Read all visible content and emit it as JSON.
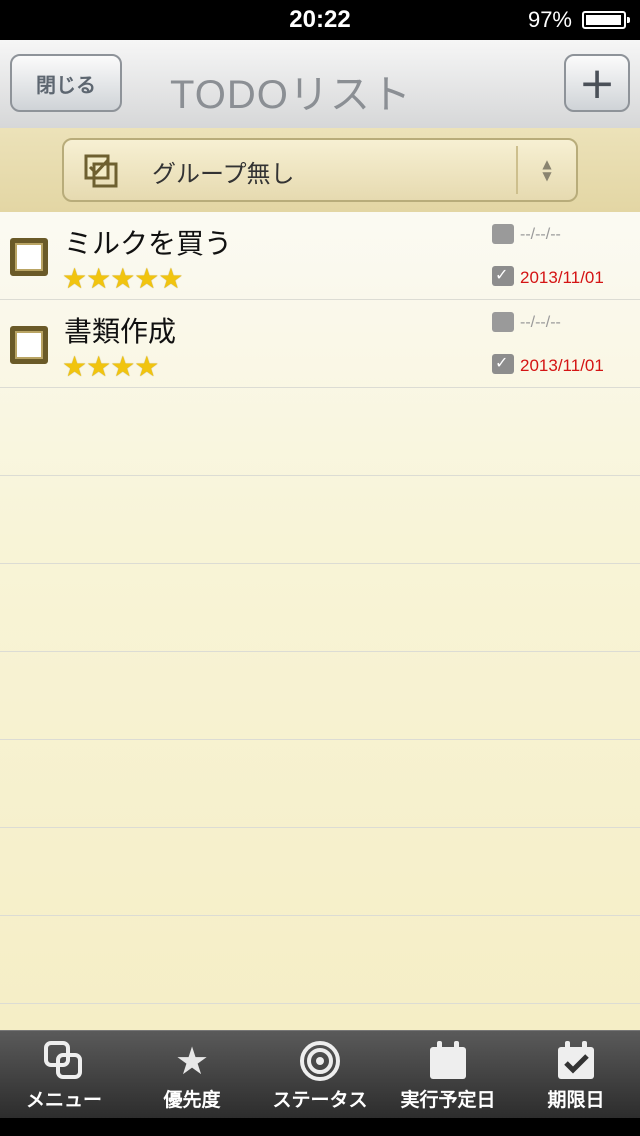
{
  "status_bar": {
    "time": "20:22",
    "battery": "97%",
    "battery_level": 0.97
  },
  "nav": {
    "close_label": "閉じる",
    "title": "TODOリスト",
    "add_label": "+"
  },
  "group": {
    "selected": "グループ無し",
    "icon": "checkbox-group-icon"
  },
  "tasks": [
    {
      "title": "ミルクを買う",
      "stars": "★★★★★",
      "priority": 5,
      "plan_date": "--/--/--",
      "due_date": "2013/11/01"
    },
    {
      "title": "書類作成",
      "stars": "★★★★",
      "priority": 4,
      "plan_date": "--/--/--",
      "due_date": "2013/11/01"
    }
  ],
  "tabs": [
    {
      "label": "メニュー",
      "icon": "menu-icon"
    },
    {
      "label": "優先度",
      "icon": "star-icon"
    },
    {
      "label": "ステータス",
      "icon": "target-icon"
    },
    {
      "label": "実行予定日",
      "icon": "calendar-icon"
    },
    {
      "label": "期限日",
      "icon": "calendar-check-icon"
    }
  ],
  "colors": {
    "due_date": "#d41414",
    "star": "#f1c40f"
  }
}
